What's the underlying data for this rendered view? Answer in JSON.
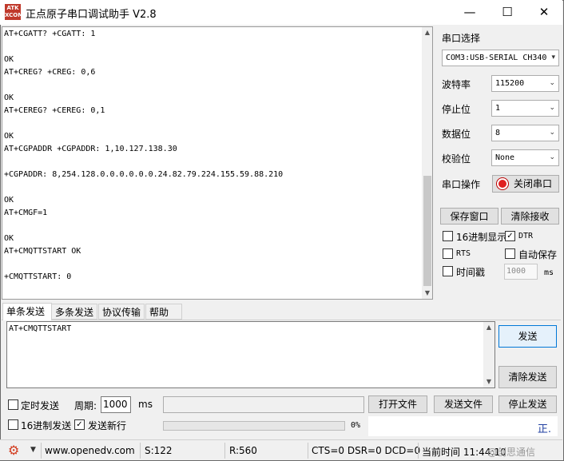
{
  "window": {
    "title": "正点原子串口调试助手 V2.8",
    "logo_text": "ATK\nXCOM",
    "minimize": "—",
    "maximize": "☐",
    "close": "✕"
  },
  "receive": {
    "lines": [
      "AT+CGATT? +CGATT: 1",
      "",
      "OK",
      "AT+CREG? +CREG: 0,6",
      "",
      "OK",
      "AT+CEREG? +CEREG: 0,1",
      "",
      "OK",
      "AT+CGPADDR +CGPADDR: 1,10.127.138.30",
      "",
      "+CGPADDR: 8,254.128.0.0.0.0.0.0.24.82.79.224.155.59.88.210",
      "",
      "OK",
      "AT+CMGF=1",
      "",
      "OK",
      "AT+CMQTTSTART OK",
      "",
      "+CMQTTSTART: 0"
    ]
  },
  "port": {
    "select_label": "串口选择",
    "port_value": "COM3:USB-SERIAL CH340",
    "baud_label": "波特率",
    "baud_value": "115200",
    "stop_label": "停止位",
    "stop_value": "1",
    "data_label": "数据位",
    "data_value": "8",
    "parity_label": "校验位",
    "parity_value": "None",
    "op_label": "串口操作",
    "op_button": "关闭串口",
    "save_window": "保存窗口",
    "clear_recv": "清除接收",
    "hex_display": "16进制显示",
    "hex_display_checked": false,
    "dtr": "DTR",
    "dtr_checked": true,
    "rts": "RTS",
    "rts_checked": false,
    "auto_save": "自动保存",
    "auto_save_checked": false,
    "timestamp": "时间戳",
    "timestamp_checked": false,
    "timestamp_value": "1000",
    "timestamp_unit": "ms"
  },
  "tabs": [
    "单条发送",
    "多条发送",
    "协议传输",
    "帮助"
  ],
  "send": {
    "text": "AT+CMQTTSTART",
    "send_button": "发送",
    "clear_send": "清除发送",
    "timed_send": "定时发送",
    "timed_checked": false,
    "period_label": "周期:",
    "period_value": "1000",
    "period_unit": "ms",
    "open_file": "打开文件",
    "send_file": "发送文件",
    "stop_send": "停止发送",
    "hex_send": "16进制发送",
    "hex_send_checked": false,
    "newline": "发送新行",
    "newline_checked": true,
    "progress_text": "0%",
    "progress_value": 0,
    "corner_text": "正."
  },
  "status": {
    "url": "www.openedv.com",
    "sent": "S:122",
    "received": "R:560",
    "signals": "CTS=0 DSR=0 DCD=0",
    "time": "当前时间 11:44:10",
    "watermark": "@创思通信"
  }
}
